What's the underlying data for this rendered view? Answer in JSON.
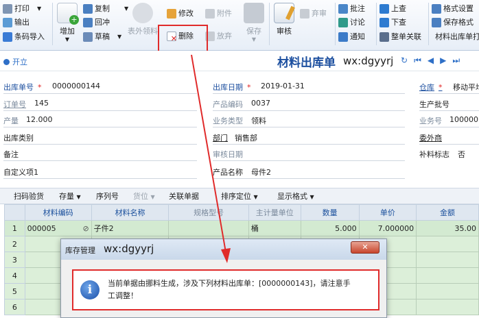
{
  "ribbon": {
    "print": "打印",
    "output": "输出",
    "barcode_import": "条码导入",
    "add": "增加",
    "copy": "复制",
    "write_back": "回冲",
    "draft": "草稿",
    "table_outside": "表外领料",
    "modify": "修改",
    "attachment": "附件",
    "delete": "删除",
    "abandon": "放弃",
    "save": "保存",
    "audit": "审核",
    "unaudit": "弃审",
    "comment": "批注",
    "discuss": "讨论",
    "notify": "通知",
    "prev": "上查",
    "next": "下查",
    "whole_link": "整单关联",
    "format_settings": "格式设置",
    "save_format": "保存格式",
    "material_issue_print": "材料出库单打"
  },
  "toolbar": {
    "open": "开立",
    "doc_title": "材料出库单",
    "watermark": "wx:dgyyrj"
  },
  "form": {
    "issue_no_label": "出库单号",
    "issue_no": "0000000144",
    "issue_date_label": "出库日期",
    "issue_date": "2019-01-31",
    "warehouse_label": "仓库",
    "warehouse": "移动平均",
    "order_no_label": "订单号",
    "order_no": "145",
    "product_code_label": "产品编码",
    "product_code": "0037",
    "batch_label": "生产批号",
    "quantity_label": "产量",
    "quantity": "12.000",
    "biz_type_label": "业务类型",
    "biz_type": "领料",
    "biz_no_label": "业务号",
    "biz_no": "100000",
    "issue_cat_label": "出库类别",
    "dept_label": "部门",
    "dept": "销售部",
    "outsourcer_label": "委外商",
    "remark_label": "备注",
    "audit_date_label": "审核日期",
    "supplement_label": "补料标志",
    "supplement": "否",
    "custom1_label": "自定义项1",
    "product_name_label": "产品名称",
    "product_name": "母件2"
  },
  "gridbar": {
    "scan": "扫码验货",
    "stock": "存量",
    "serial": "序列号",
    "slot": "货位",
    "link": "关联单据",
    "sort": "排序定位",
    "display": "显示格式"
  },
  "grid": {
    "headers": [
      "材料编码",
      "材料名称",
      "规格型号",
      "主计量单位",
      "数量",
      "单价",
      "金额"
    ],
    "rows": [
      {
        "no": "1",
        "code": "000005",
        "name": "子件2",
        "spec": "",
        "unit": "桶",
        "qty": "5.000",
        "price": "7.000000",
        "amount": "35.00"
      },
      {
        "no": "2"
      },
      {
        "no": "3"
      },
      {
        "no": "4"
      },
      {
        "no": "5"
      },
      {
        "no": "6"
      }
    ]
  },
  "dialog": {
    "title": "库存管理",
    "watermark": "wx:dgyyrj",
    "message_line1": "当前单据由挪料生成，涉及下列材料出库单：[0000000143]，请注意手",
    "message_line2": "工调整！"
  }
}
